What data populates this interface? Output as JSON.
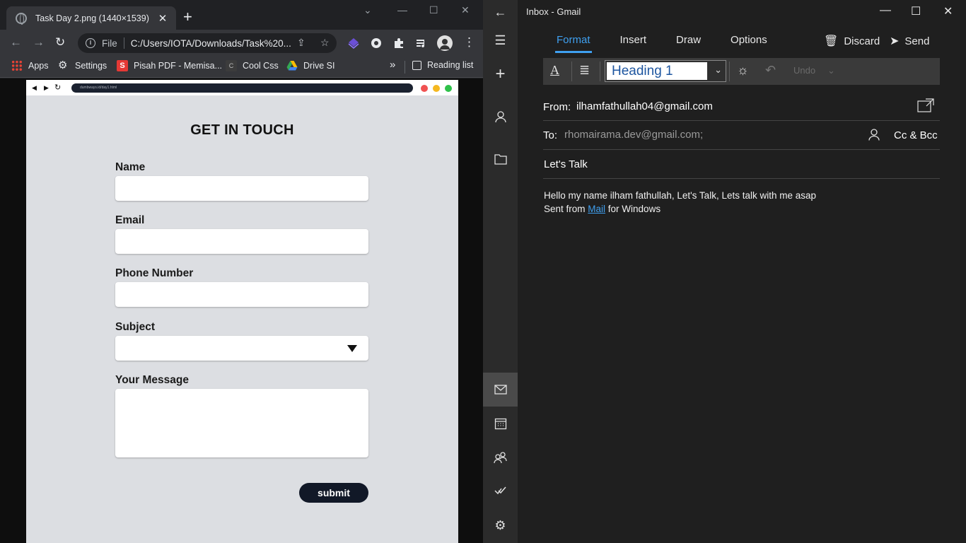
{
  "browser": {
    "tab_title": "Task Day 2.png (1440×1539)",
    "omnibox": {
      "scheme": "File",
      "url": "C:/Users/IOTA/Downloads/Task%20..."
    },
    "bookmarks": [
      "Apps",
      "Settings",
      "Pisah PDF - Memisa...",
      "Cool Css",
      "Drive SI"
    ],
    "more_bookmarks": "»",
    "reading_list": "Reading list"
  },
  "page": {
    "mock_url": "dumbways.id/day1.html",
    "heading": "GET IN TOUCH",
    "fields": [
      "Name",
      "Email",
      "Phone Number",
      "Subject",
      "Your Message"
    ],
    "submit_label": "submit",
    "dot_colors": [
      "#f05252",
      "#f5b820",
      "#2fc14a"
    ]
  },
  "mail": {
    "window_title": "Inbox - Gmail",
    "tabs": [
      "Format",
      "Insert",
      "Draw",
      "Options"
    ],
    "discard_label": "Discard",
    "send_label": "Send",
    "style_value": "Heading 1",
    "undo_label": "Undo",
    "from_label": "From:",
    "from_value": "ilhamfathullah04@gmail.com",
    "to_label": "To:",
    "to_value": "rhomairama.dev@gmail.com;",
    "cc_label": "Cc & Bcc",
    "subject": "Let's Talk",
    "body_line1": "Hello my name ilham fathullah, Let's Talk, Lets talk with me asap",
    "body_line2_prefix": "Sent from ",
    "body_link": "Mail",
    "body_line2_suffix": " for Windows",
    "accent": "#3fa0f0"
  }
}
